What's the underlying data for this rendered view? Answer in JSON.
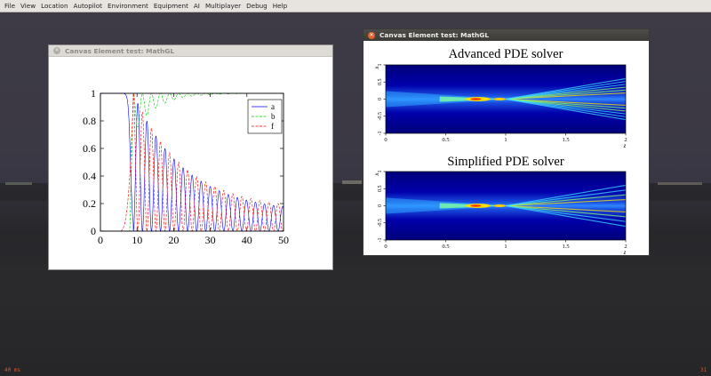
{
  "menubar": {
    "items": [
      "File",
      "View",
      "Location",
      "Autopilot",
      "Environment",
      "Equipment",
      "AI",
      "Multiplayer",
      "Debug",
      "Help"
    ]
  },
  "status": {
    "frame_latency": "40 ms",
    "fps": "31"
  },
  "windows": {
    "left": {
      "title": "Canvas Element test: MathGL"
    },
    "right": {
      "title": "Canvas Element test: MathGL"
    }
  },
  "colors": {
    "series_a": "#0000ff",
    "series_b": "#00cc00",
    "series_f": "#ff0000",
    "inactive_close": "#b0aca6",
    "active_close": "#e2622c"
  },
  "icons": {
    "window_close": "close-icon"
  },
  "chart_data": [
    {
      "type": "line",
      "title": "",
      "xlabel": "",
      "ylabel": "",
      "xlim": [
        0,
        50
      ],
      "ylim": [
        0,
        1
      ],
      "x_ticks": [
        0,
        10,
        20,
        30,
        40,
        50
      ],
      "y_ticks": [
        0,
        0.2,
        0.4,
        0.6,
        0.8,
        1
      ],
      "x_tick_labels": [
        "0",
        "10",
        "20",
        "30",
        "40",
        "50"
      ],
      "y_tick_labels": [
        "0",
        "0.2",
        "0.4",
        "0.6",
        "0.8",
        "1"
      ],
      "legend": {
        "position": "top-right",
        "entries": [
          "a",
          "b",
          "f"
        ]
      },
      "grid": false,
      "series": [
        {
          "name": "a",
          "color": "#0000ff",
          "x": [
            0,
            5,
            6,
            7,
            7.5,
            8,
            8.5,
            9,
            9.5,
            10,
            11,
            12,
            13,
            14,
            15,
            16,
            18,
            20,
            25,
            30,
            35,
            40,
            45,
            50
          ],
          "y": [
            1,
            1,
            0.998,
            0.97,
            0.9,
            0.7,
            0.35,
            0.08,
            0,
            0.2,
            0.9,
            0.05,
            0.75,
            0.02,
            0.7,
            0.03,
            0.62,
            0.55,
            0.45,
            0.36,
            0.29,
            0.23,
            0.18,
            0.14
          ]
        },
        {
          "name": "b",
          "color": "#00cc00",
          "x": [
            0,
            8,
            9,
            10,
            11,
            12,
            13,
            14,
            15,
            16,
            18,
            20,
            25,
            30,
            35,
            40,
            45,
            50
          ],
          "y": [
            0,
            0.95,
            1,
            0.8,
            1,
            0.72,
            1,
            0.75,
            1,
            0.82,
            0.86,
            0.9,
            0.93,
            0.95,
            0.97,
            0.98,
            0.99,
            1
          ]
        },
        {
          "name": "f",
          "color": "#ff0000",
          "x": [
            0,
            5,
            6,
            7,
            8,
            8.5,
            9,
            10,
            11,
            12,
            13,
            14,
            15,
            16,
            18,
            20,
            25,
            30,
            35,
            40,
            45,
            50
          ],
          "y": [
            0,
            0.005,
            0.03,
            0.12,
            0.6,
            0.9,
            0.98,
            0,
            0.9,
            0.02,
            0.82,
            0.05,
            0.72,
            0.05,
            0.64,
            0.57,
            0.46,
            0.37,
            0.3,
            0.24,
            0.19,
            0.15
          ]
        }
      ]
    },
    {
      "type": "heatmap",
      "title": "Advanced PDE solver",
      "xlabel": "z",
      "ylabel": "x",
      "xlim": [
        0,
        2
      ],
      "ylim": [
        -1,
        1
      ],
      "x_tick_labels": [
        "0",
        "0.5",
        "1",
        "1.5",
        "2"
      ],
      "y_tick_labels": [
        "-1",
        "-0.5",
        "0",
        "0.5",
        "1"
      ],
      "focus": 1.0,
      "beams": 6,
      "grid": false
    },
    {
      "type": "heatmap",
      "title": "Simplified PDE solver",
      "xlabel": "z",
      "ylabel": "x",
      "xlim": [
        0,
        2
      ],
      "ylim": [
        -1,
        1
      ],
      "x_tick_labels": [
        "0",
        "0.5",
        "1",
        "1.5",
        "2"
      ],
      "y_tick_labels": [
        "-1",
        "-0.5",
        "0",
        "0.5",
        "1"
      ],
      "focus": 1.0,
      "beams": 4,
      "grid": false
    }
  ]
}
